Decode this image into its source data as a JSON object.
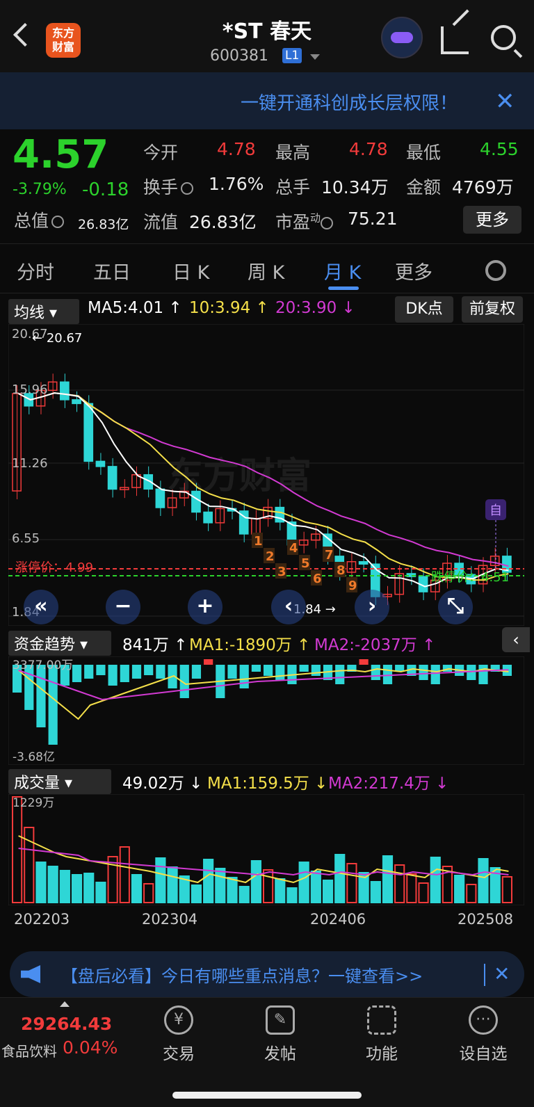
{
  "header": {
    "title": "*ST 春天",
    "code": "600381",
    "badge": "L1",
    "logo_line1": "东方",
    "logo_line2": "财富"
  },
  "banner": {
    "text": "一键开通科创成长层权限！",
    "close": "✕"
  },
  "quote": {
    "price": "4.57",
    "change_pct": "-3.79%",
    "change": "-0.18",
    "total_value_label": "总值",
    "total_value": "26.83亿",
    "stats": [
      {
        "label": "今开",
        "value": "4.78",
        "color": "red"
      },
      {
        "label": "最高",
        "value": "4.78",
        "color": "red"
      },
      {
        "label": "最低",
        "value": "4.55",
        "color": "green"
      },
      {
        "label": "换手",
        "value": "1.76%",
        "color": "white"
      },
      {
        "label": "总手",
        "value": "10.34万",
        "color": "white"
      },
      {
        "label": "金额",
        "value": "4769万",
        "color": "white"
      },
      {
        "label": "流值",
        "value": "26.83亿",
        "color": "white"
      },
      {
        "label": "市盈",
        "sup": "动",
        "value": "75.21",
        "color": "white"
      }
    ],
    "more_button": "更多"
  },
  "tabs": [
    "分时",
    "五日",
    "日 K",
    "周 K",
    "月 K",
    "更多"
  ],
  "active_tab": "月 K",
  "ma_bar": {
    "selector": "均线",
    "ma5": "MA5:4.01",
    "ma10": "10:3.94",
    "ma20": "20:3.90",
    "dk_button": "DK点",
    "adjust_button": "前复权"
  },
  "kline": {
    "price_labels": [
      "20.67",
      "15.96",
      "11.26",
      "6.55",
      "1.84"
    ],
    "high_marker": "20.67",
    "low_marker": "1.84",
    "limit_up_label": "涨停价：4.99",
    "limit_down_label": "跌停价：4.51",
    "nine_turn": [
      "1",
      "2",
      "3",
      "4",
      "5",
      "6",
      "7",
      "8",
      "9"
    ],
    "self_marker": "自",
    "watermark": "东方财富",
    "controls": [
      "«",
      "−",
      "+",
      "‹",
      "›",
      "⤡"
    ]
  },
  "fund_panel": {
    "selector": "资金趋势",
    "value": "841万",
    "ma1": "MA1:-1890万",
    "ma2": "MA2:-2037万",
    "top": "3377.00万",
    "bottom": "-3.68亿"
  },
  "volume_panel": {
    "selector": "成交量",
    "value": "49.02万",
    "ma1": "MA1:159.5万",
    "ma2": "MA2:217.4万",
    "top": "1229万"
  },
  "x_axis": [
    "202203",
    "202304",
    "202406",
    "202508"
  ],
  "notice": {
    "text": "【盘后必看】今日有哪些重点消息？一键查看>>"
  },
  "bottom_bar": {
    "index_value": "29264.43",
    "index_name": "食品饮料",
    "index_change": "0.04%",
    "items": [
      {
        "label": "交易",
        "icon": "yen-icon"
      },
      {
        "label": "发帖",
        "icon": "edit-icon"
      },
      {
        "label": "功能",
        "icon": "grid-icon"
      },
      {
        "label": "设自选",
        "icon": "more-icon"
      }
    ]
  },
  "colors": {
    "up": "#f23b3b",
    "down": "#2cd22c",
    "accent": "#4a8ef0",
    "ma5": "#ffffff",
    "ma10": "#f5e04a",
    "ma20": "#d23ad2",
    "candle_down": "#2ed6d6"
  }
}
